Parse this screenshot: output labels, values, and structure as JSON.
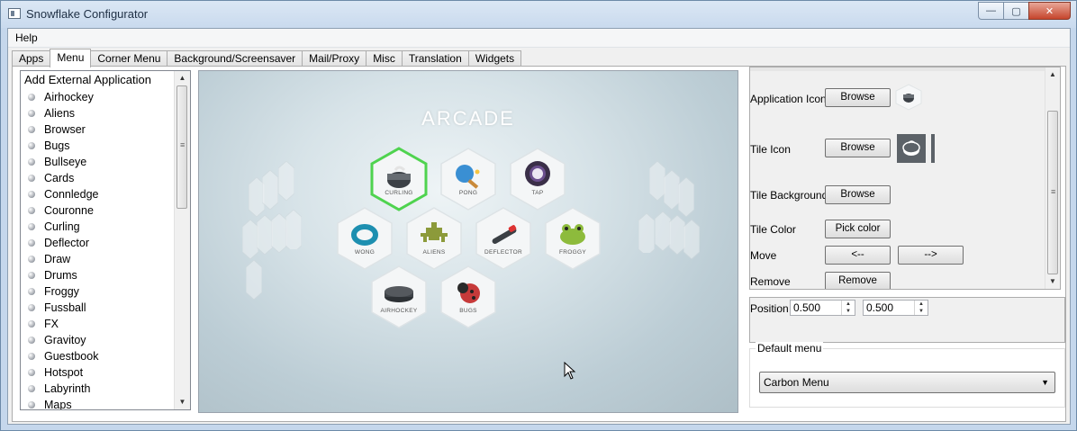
{
  "window": {
    "title": "Snowflake Configurator",
    "controls": {
      "minimize": "—",
      "maximize": "▢",
      "close": "✕"
    }
  },
  "menubar": {
    "items": [
      "Help"
    ]
  },
  "tabs": [
    "Apps",
    "Menu",
    "Corner Menu",
    "Background/Screensaver",
    "Mail/Proxy",
    "Misc",
    "Translation",
    "Widgets"
  ],
  "active_tab": "Menu",
  "app_list": {
    "header": "Add External Application",
    "items": [
      "Airhockey",
      "Aliens",
      "Browser",
      "Bugs",
      "Bullseye",
      "Cards",
      "Connledge",
      "Couronne",
      "Curling",
      "Deflector",
      "Draw",
      "Drums",
      "Froggy",
      "Fussball",
      "FX",
      "Gravitoy",
      "Guestbook",
      "Hotspot",
      "Labyrinth",
      "Maps"
    ]
  },
  "preview": {
    "title": "ARCADE",
    "tiles": [
      "CURLING",
      "PONG",
      "TAP",
      "WONG",
      "ALIENS",
      "DEFLECTOR",
      "FROGGY",
      "AIRHOCKEY",
      "BUGS"
    ]
  },
  "properties": {
    "app_icon_label": "Application Icon",
    "tile_icon_label": "Tile Icon",
    "tile_background_label": "Tile Background",
    "tile_color_label": "Tile Color",
    "move_label": "Move",
    "remove_label": "Remove",
    "browse": "Browse",
    "pick_color": "Pick color",
    "move_left": "<--",
    "move_right": "-->",
    "remove_button": "Remove"
  },
  "position": {
    "label": "Position",
    "x": "0.500",
    "y": "0.500"
  },
  "default_menu": {
    "title": "Default menu",
    "selected": "Carbon Menu"
  },
  "colors": {
    "accent_selected": "#4fd34f",
    "tile_face": "#f4f6f7"
  }
}
